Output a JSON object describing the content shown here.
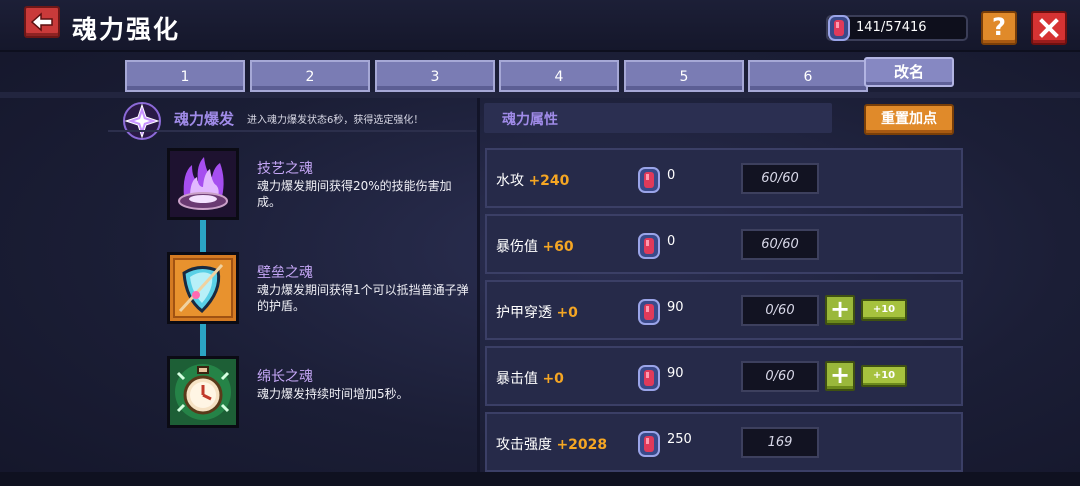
{
  "header": {
    "title": "魂力强化",
    "currency": "141/57416"
  },
  "tabs": [
    "1",
    "2",
    "3",
    "4",
    "5",
    "6"
  ],
  "rename_label": "改名",
  "burst": {
    "title": "魂力爆发",
    "desc": "进入魂力爆发状态6秒，获得选定强化！"
  },
  "souls": [
    {
      "name": "技艺之魂",
      "desc": "魂力爆发期间获得20%的技能伤害加成。",
      "icon": "purple-flame-icon"
    },
    {
      "name": "壁垒之魂",
      "desc": "魂力爆发期间获得1个可以抵挡普通子弹的护盾。",
      "icon": "shield-icon"
    },
    {
      "name": "绵长之魂",
      "desc": "魂力爆发持续时间增加5秒。",
      "icon": "stopwatch-icon"
    }
  ],
  "attr": {
    "header": "魂力属性",
    "reset_label": "重置加点",
    "rows": [
      {
        "label": "水攻",
        "bonus": "+240",
        "cost": "0",
        "level": "60/60",
        "plus": ""
      },
      {
        "label": "暴伤值",
        "bonus": "+60",
        "cost": "0",
        "level": "60/60",
        "plus": ""
      },
      {
        "label": "护甲穿透",
        "bonus": "+0",
        "cost": "90",
        "level": "0/60",
        "plus": "+",
        "plus10": "+10"
      },
      {
        "label": "暴击值",
        "bonus": "+0",
        "cost": "90",
        "level": "0/60",
        "plus": "+",
        "plus10": "+10"
      },
      {
        "label": "攻击强度",
        "bonus": "+2028",
        "cost": "250",
        "level": "169",
        "plus": ""
      }
    ]
  },
  "colors": {
    "accent_purple": "#a08be8",
    "bonus_orange": "#f5a623",
    "button_orange": "#e08a2a",
    "button_red": "#d63333",
    "button_green": "#9ab83b",
    "tab_purple": "#7a7cb4"
  }
}
